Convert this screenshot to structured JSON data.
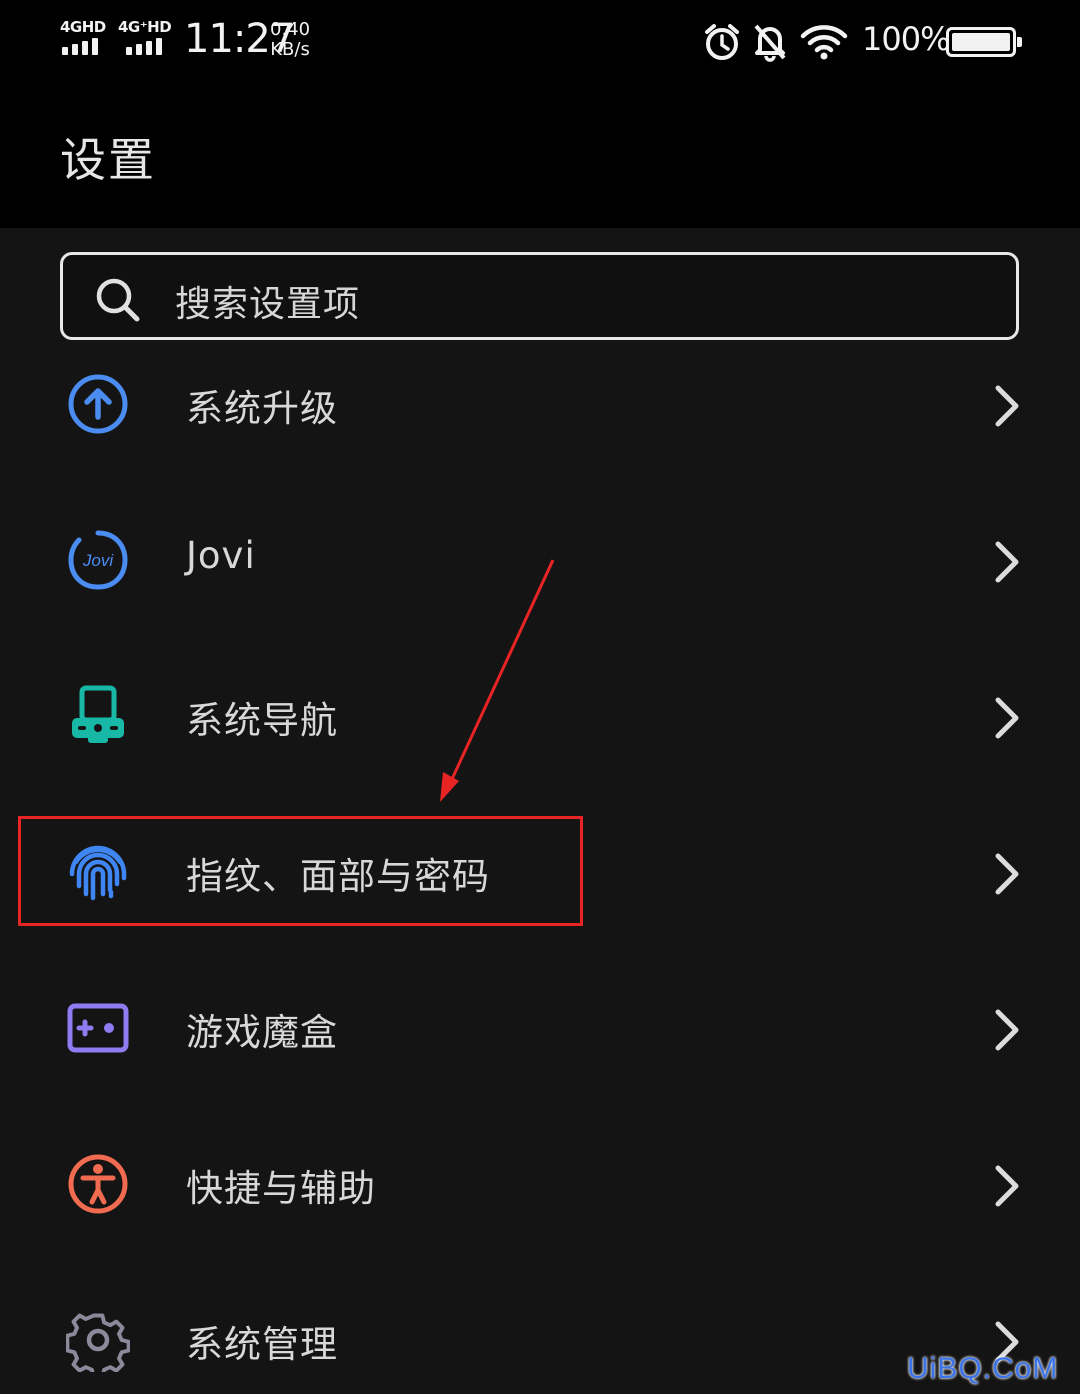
{
  "status_bar": {
    "sim1_label": "4GHD",
    "sim2_label": "4G⁺HD",
    "time": "11:27",
    "speed_value": "0.40",
    "speed_unit": "KB/s",
    "battery_percent": "100%",
    "icons": [
      "signal-icon",
      "alarm-icon",
      "bell-off-icon",
      "wifi-icon",
      "battery-icon"
    ]
  },
  "header": {
    "title": "设置"
  },
  "search": {
    "placeholder": "搜索设置项"
  },
  "menu": {
    "items": [
      {
        "label": "系统升级",
        "icon": "upgrade-arrow-icon",
        "color": "#4a8cf0"
      },
      {
        "label": "Jovi",
        "icon": "jovi-icon",
        "color": "#4a8cf0"
      },
      {
        "label": "系统导航",
        "icon": "navigation-device-icon",
        "color": "#17b8a6"
      },
      {
        "label": "指纹、面部与密码",
        "icon": "fingerprint-icon",
        "color": "#3f86f2"
      },
      {
        "label": "游戏魔盒",
        "icon": "game-box-icon",
        "color": "#8e7cf0"
      },
      {
        "label": "快捷与辅助",
        "icon": "accessibility-icon",
        "color": "#f06b4f"
      },
      {
        "label": "系统管理",
        "icon": "gear-icon",
        "color": "#8a8a9a"
      }
    ]
  },
  "annotation": {
    "highlight_color": "#e82424",
    "highlighted_item": "指纹、面部与密码"
  },
  "watermark": "UiBQ.CoM"
}
